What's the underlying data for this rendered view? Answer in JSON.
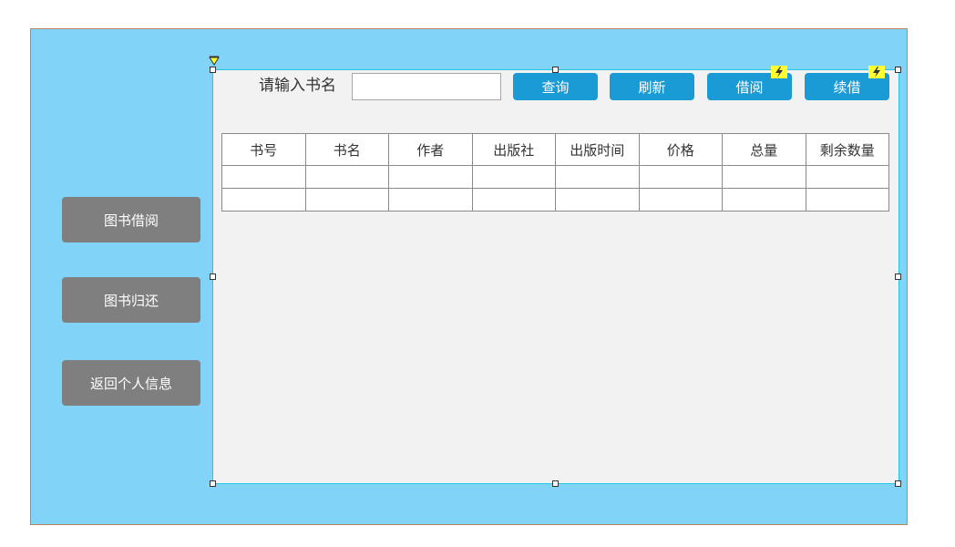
{
  "sidebar": {
    "items": [
      {
        "label": "图书借阅"
      },
      {
        "label": "图书归还"
      },
      {
        "label": "返回个人信息"
      }
    ]
  },
  "search": {
    "label": "请输入书名",
    "value": "",
    "placeholder": ""
  },
  "toolbar": {
    "query_label": "查询",
    "refresh_label": "刷新",
    "borrow_label": "借阅",
    "renew_label": "续借"
  },
  "table": {
    "headers": [
      "书号",
      "书名",
      "作者",
      "出版社",
      "出版时间",
      "价格",
      "总量",
      "剩余数量"
    ],
    "rows": [
      [
        "",
        "",
        "",
        "",
        "",
        "",
        "",
        ""
      ],
      [
        "",
        "",
        "",
        "",
        "",
        "",
        "",
        ""
      ]
    ]
  },
  "colors": {
    "canvas_background": "#81d3f8",
    "panel_background": "#f2f2f2",
    "sidebar_button": "#7f7f7f",
    "toolbar_button": "#1b9bd5",
    "interaction_marker": "#ffff33"
  },
  "icons": {
    "pin": "pin-icon",
    "interaction": "lightning-icon"
  }
}
